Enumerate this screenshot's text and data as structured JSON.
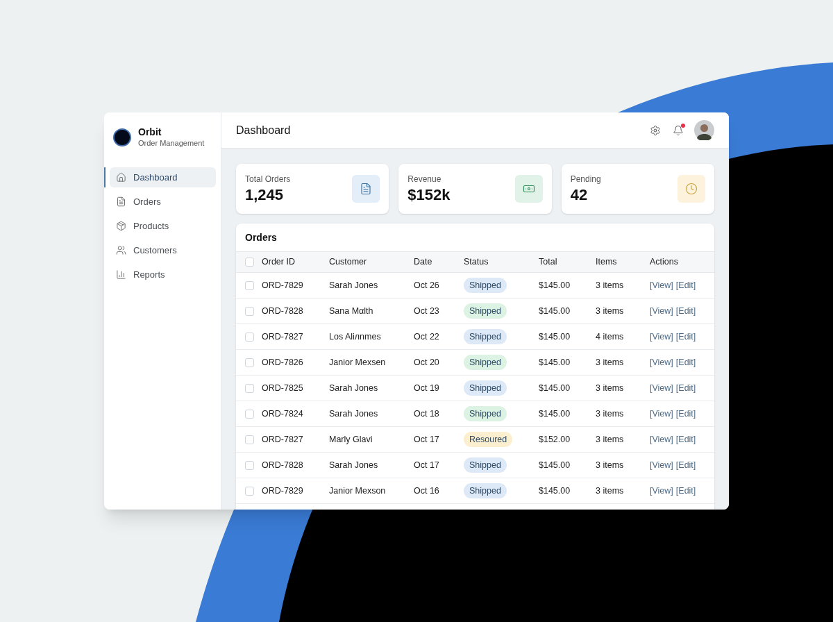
{
  "brand": {
    "name": "Orbit",
    "subtitle": "Order Management"
  },
  "nav": [
    {
      "label": "Dashboard",
      "kind": "home",
      "selected": true
    },
    {
      "label": "Orders",
      "kind": "file",
      "selected": false
    },
    {
      "label": "Products",
      "kind": "box",
      "selected": false
    },
    {
      "label": "Customers",
      "kind": "users",
      "selected": false
    },
    {
      "label": "Reports",
      "kind": "chart",
      "selected": false
    }
  ],
  "header": {
    "title": "Dashboard",
    "notification_dot": true
  },
  "stats": [
    {
      "label": "Total Orders",
      "value": "1,245",
      "kind": "file",
      "color": "#e3eef9"
    },
    {
      "label": "Revenue",
      "value": "$152k",
      "kind": "money",
      "color": "#e1f3e8"
    },
    {
      "label": "Pending",
      "value": "42",
      "kind": "clock",
      "color": "#fdf3dc"
    }
  ],
  "orders": {
    "title": "Orders",
    "all_checked": false,
    "columns": [
      "Order ID",
      "Customer",
      "Date",
      "Status",
      "Total",
      "Items",
      "Actions"
    ],
    "rows": [
      {
        "id": "ORD-7829",
        "customer": "Sarah Jones",
        "date": "Oct 26",
        "status": {
          "text": "Shipped",
          "color": "#dde9f7"
        },
        "total": "$145.00",
        "items": "3 items",
        "actions": [
          "[View]",
          "[Edit]"
        ],
        "checked": false
      },
      {
        "id": "ORD-7828",
        "customer": "Sana Mαlth",
        "date": "Oct 23",
        "status": {
          "text": "Shipped",
          "color": "#dcf2e3"
        },
        "total": "$145.00",
        "items": "3 items",
        "actions": [
          "[View]",
          "[Edit]"
        ],
        "checked": false
      },
      {
        "id": "ORD-7827",
        "customer": "Los Aliлnmes",
        "date": "Oct 22",
        "status": {
          "text": "Shipped",
          "color": "#dde9f7"
        },
        "total": "$145.00",
        "items": "4 items",
        "actions": [
          "[View]",
          "[Edit]"
        ],
        "checked": false
      },
      {
        "id": "ORD-7826",
        "customer": "Janior Mexsen",
        "date": "Oct 20",
        "status": {
          "text": "Shipped",
          "color": "#dcf2e3"
        },
        "total": "$145.00",
        "items": "3 items",
        "actions": [
          "[View]",
          "[Edit]"
        ],
        "checked": false
      },
      {
        "id": "ORD-7825",
        "customer": "Sarah Jones",
        "date": "Oct 19",
        "status": {
          "text": "Shipped",
          "color": "#dde9f7"
        },
        "total": "$145.00",
        "items": "3 items",
        "actions": [
          "[View]",
          "[Edit]"
        ],
        "checked": false
      },
      {
        "id": "ORD-7824",
        "customer": "Sarah Jones",
        "date": "Oct 18",
        "status": {
          "text": "Shipped",
          "color": "#dcf2e3"
        },
        "total": "$145.00",
        "items": "3 items",
        "actions": [
          "[View]",
          "[Edit]"
        ],
        "checked": false
      },
      {
        "id": "ORD-7827",
        "customer": "Marly Glavi",
        "date": "Oct 17",
        "status": {
          "text": "Resoured",
          "color": "#fcefcf"
        },
        "total": "$152.00",
        "items": "3 items",
        "actions": [
          "[View]",
          "[Edit]"
        ],
        "checked": false
      },
      {
        "id": "ORD-7828",
        "customer": "Sarah Jones",
        "date": "Oct 17",
        "status": {
          "text": "Shipped",
          "color": "#dde9f7"
        },
        "total": "$145.00",
        "items": "3 items",
        "actions": [
          "[View]",
          "[Edit]"
        ],
        "checked": false
      },
      {
        "id": "ORD-7829",
        "customer": "Janior Mexson",
        "date": "Oct 16",
        "status": {
          "text": "Shipped",
          "color": "#dde9f7"
        },
        "total": "$145.00",
        "items": "3 items",
        "actions": [
          "[View]",
          "[Edit]"
        ],
        "checked": false
      }
    ]
  }
}
